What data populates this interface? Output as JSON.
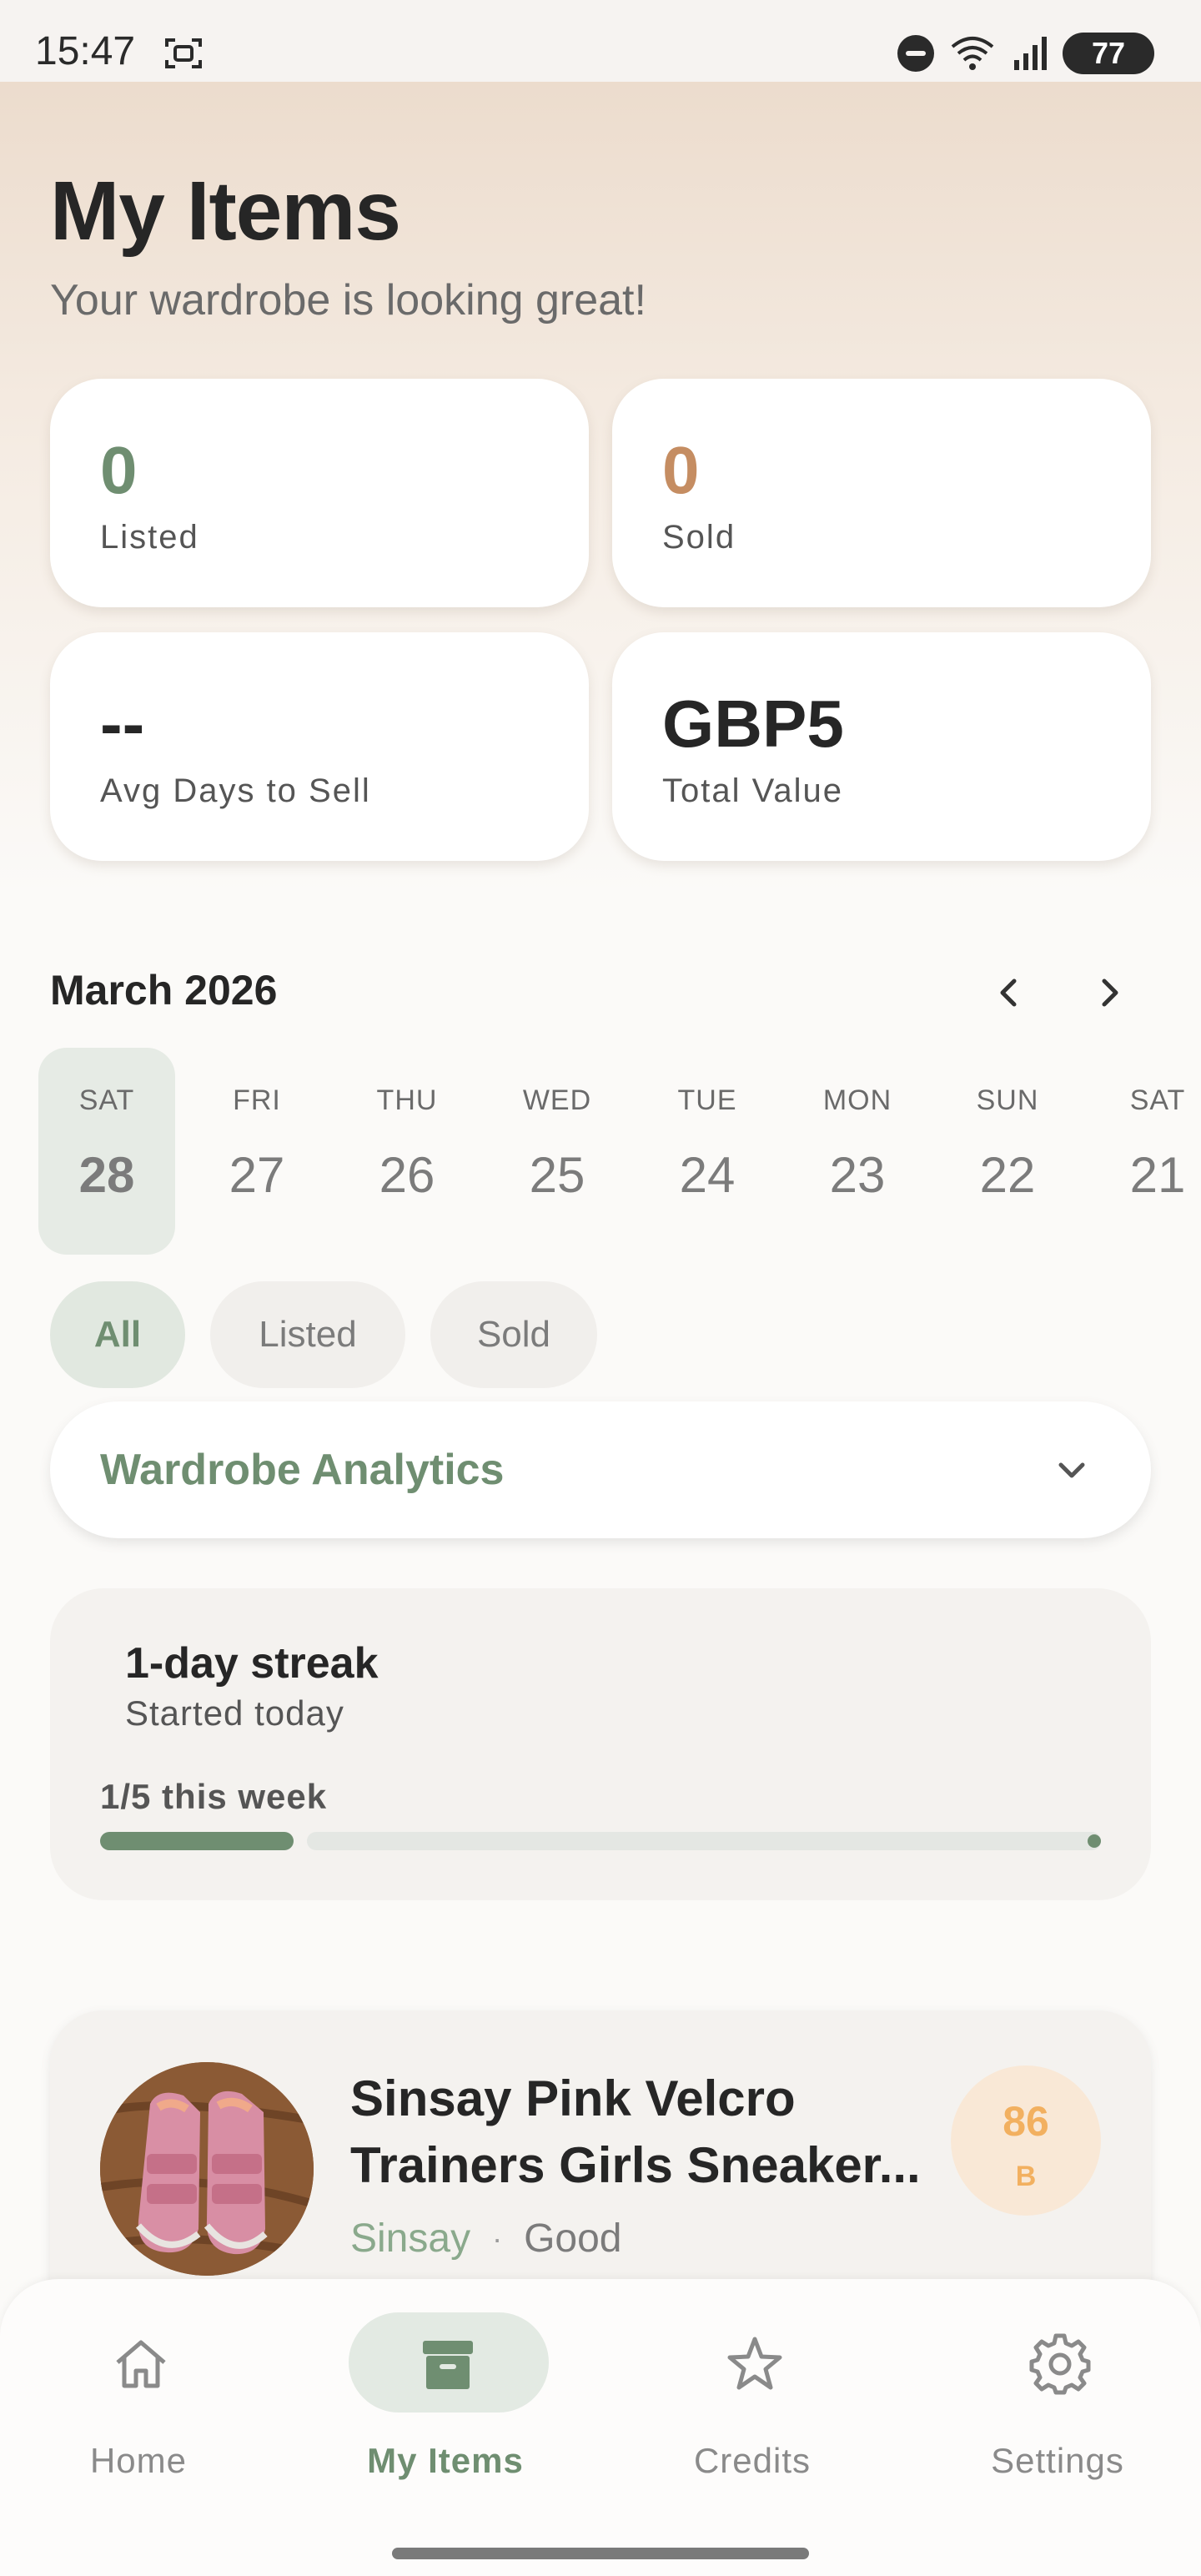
{
  "status_bar": {
    "time": "15:47",
    "battery": "77"
  },
  "header": {
    "title": "My Items",
    "subtitle": "Your wardrobe is looking great!"
  },
  "stats": [
    {
      "value": "0",
      "label": "Listed",
      "color": "#6f8e71"
    },
    {
      "value": "0",
      "label": "Sold",
      "color": "#c58d62"
    },
    {
      "value": "--",
      "label": "Avg Days to Sell",
      "color": "#262626"
    },
    {
      "value": "GBP5",
      "label": "Total Value",
      "color": "#262626"
    }
  ],
  "calendar": {
    "month": "March 2026",
    "days": [
      {
        "name": "SAT",
        "num": "28",
        "selected": true
      },
      {
        "name": "FRI",
        "num": "27"
      },
      {
        "name": "THU",
        "num": "26"
      },
      {
        "name": "WED",
        "num": "25"
      },
      {
        "name": "TUE",
        "num": "24"
      },
      {
        "name": "MON",
        "num": "23"
      },
      {
        "name": "SUN",
        "num": "22"
      },
      {
        "name": "SAT",
        "num": "21"
      }
    ]
  },
  "filters": {
    "all": "All",
    "listed": "Listed",
    "sold": "Sold",
    "active": "All"
  },
  "analytics": {
    "label": "Wardrobe Analytics"
  },
  "streak": {
    "title": "1-day streak",
    "subtitle": "Started today",
    "week_progress": "1/5 this week",
    "progress_fraction": 0.2
  },
  "item": {
    "title_line1": "Sinsay Pink Velcro",
    "title_line2": "Trainers Girls Sneaker...",
    "brand": "Sinsay",
    "separator": "·",
    "condition": "Good",
    "score": "86",
    "grade": "B"
  },
  "nav": {
    "home": "Home",
    "my_items": "My Items",
    "credits": "Credits",
    "settings": "Settings",
    "active": "my_items"
  },
  "icons": {
    "home": "home-icon",
    "my_items": "archive-box-icon",
    "credits": "star-icon",
    "settings": "gear-icon"
  }
}
